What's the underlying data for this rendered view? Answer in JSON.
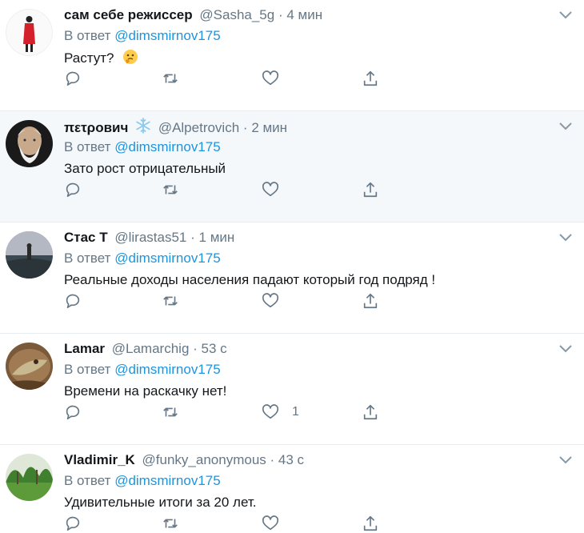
{
  "tweets": [
    {
      "name": "сам себе режиссер",
      "handle": "@Sasha_5g",
      "separator": "·",
      "time": "4 мин",
      "reply_prefix": "В ответ",
      "reply_mention": "@dimsmirnov175",
      "text": "Растут?",
      "likes": ""
    },
    {
      "name": "πετροвич",
      "handle": "@Alpetrovich",
      "separator": "·",
      "time": "2 мин",
      "reply_prefix": "В ответ",
      "reply_mention": "@dimsmirnov175",
      "text": "Зато рост отрицательный",
      "likes": ""
    },
    {
      "name": "Стас Т",
      "handle": "@lirastas51",
      "separator": "·",
      "time": "1 мин",
      "reply_prefix": "В ответ",
      "reply_mention": "@dimsmirnov175",
      "text": "Реальные доходы населения падают который год подряд !",
      "likes": ""
    },
    {
      "name": "Lamar",
      "handle": "@Lamarchig",
      "separator": "·",
      "time": "53 с",
      "reply_prefix": "В ответ",
      "reply_mention": "@dimsmirnov175",
      "text": "Времени на раскачку нет!",
      "likes": "1"
    },
    {
      "name": "Vladimir_K",
      "handle": "@funky_anonymous",
      "separator": "·",
      "time": "43 с",
      "reply_prefix": "В ответ",
      "reply_mention": "@dimsmirnov175",
      "text": "Удивительные итоги за 20 лет.",
      "likes": ""
    }
  ],
  "icons": {
    "reply": "reply-icon",
    "retweet": "retweet-icon",
    "like": "heart-icon",
    "share": "share-icon",
    "menu": "chevron-down-icon",
    "thinking_emoji": "thinking-face-icon",
    "snowflake_emoji": "snowflake-icon"
  },
  "colors": {
    "mention": "#1b95e0",
    "secondary_text": "#657786",
    "primary_text": "#14171a",
    "alt_background": "#f5f8fa",
    "divider": "#e6ecf0"
  }
}
